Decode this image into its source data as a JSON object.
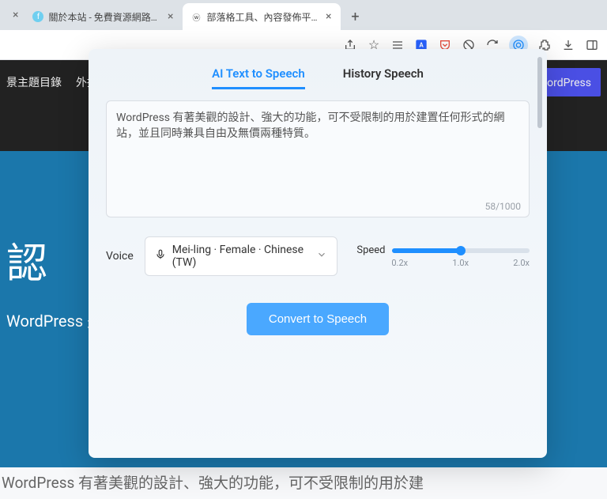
{
  "browser": {
    "tabs": [
      {
        "title": "關於本站 - 免費資源網路社群",
        "close": "×"
      },
      {
        "title": "部落格工具、內容發佈平台及 C",
        "close": "×"
      }
    ],
    "newtab": "+"
  },
  "page": {
    "nav": {
      "themes": "景主題目錄",
      "plugins": "外掛",
      "cta": "取得 WordPress"
    },
    "hero": {
      "title": "認",
      "subtitle": "WordPress 是"
    },
    "footer_text": "WordPress 有著美觀的設計、強大的功能，可不受限制的用於建"
  },
  "ext": {
    "tabs": {
      "ai": "AI Text to Speech",
      "history": "History Speech"
    },
    "textarea_value": "WordPress 有著美觀的設計、強大的功能，可不受限制的用於建置任何形式的網站，並且同時兼具自由及無價兩種特質。",
    "char_count": "58/1000",
    "voice_label": "Voice",
    "voice_value": "Mei-ling · Female · Chinese (TW)",
    "speed_label": "Speed",
    "speed_marks": {
      "min": "0.2x",
      "mid": "1.0x",
      "max": "2.0x"
    },
    "convert": "Convert to Speech"
  }
}
